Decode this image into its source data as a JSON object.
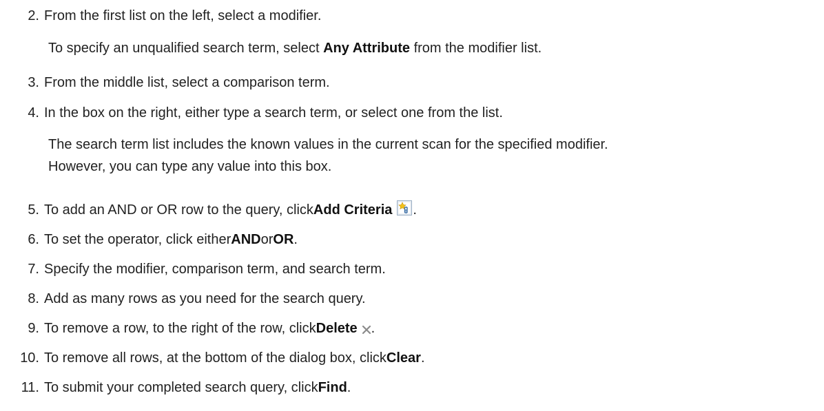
{
  "steps": [
    {
      "number": "2.",
      "text": "From the first list on the left, select a modifier."
    },
    {
      "number": "3.",
      "text": "From the middle list, select a comparison term."
    },
    {
      "number": "4.",
      "text": "In the box on the right, either type a search term, or select one from the list."
    },
    {
      "number": "5.",
      "pre": "To add an AND or OR row to the query, click ",
      "bold": "Add Criteria",
      "post": ".",
      "icon": "add-criteria-icon"
    },
    {
      "number": "6.",
      "pre": "To set the operator, click either ",
      "bold": "AND",
      "mid": " or ",
      "bold2": "OR",
      "post": "."
    },
    {
      "number": "7.",
      "text": "Specify the modifier, comparison term, and search term."
    },
    {
      "number": "8.",
      "text": "Add as many rows as you need for the search query."
    },
    {
      "number": "9.",
      "pre": "To remove a row, to the right of the row, click ",
      "bold": "Delete",
      "post": ".",
      "icon": "delete-icon"
    },
    {
      "number": "10.",
      "pre": "To remove all rows, at the bottom of the dialog box, click ",
      "bold": "Clear",
      "post": "."
    },
    {
      "number": "11.",
      "pre": "To submit your completed search query, click ",
      "bold": "Find",
      "post": "."
    }
  ],
  "notes": {
    "step2": {
      "pre": "To specify an unqualified search term, select ",
      "bold": "Any Attribute",
      "post": " from the modifier list."
    },
    "step4_line1": "The search term list includes the known values in the current scan for the specified modifier.",
    "step4_line2": "However, you can type any value into this box."
  },
  "icons": {
    "add_criteria": "add-criteria-icon",
    "delete": "delete-icon"
  },
  "colors": {
    "text": "#222222",
    "delete_icon": "#8a8a8a",
    "add_icon_border": "#9aaec4",
    "add_icon_star": "#f2c21a"
  }
}
